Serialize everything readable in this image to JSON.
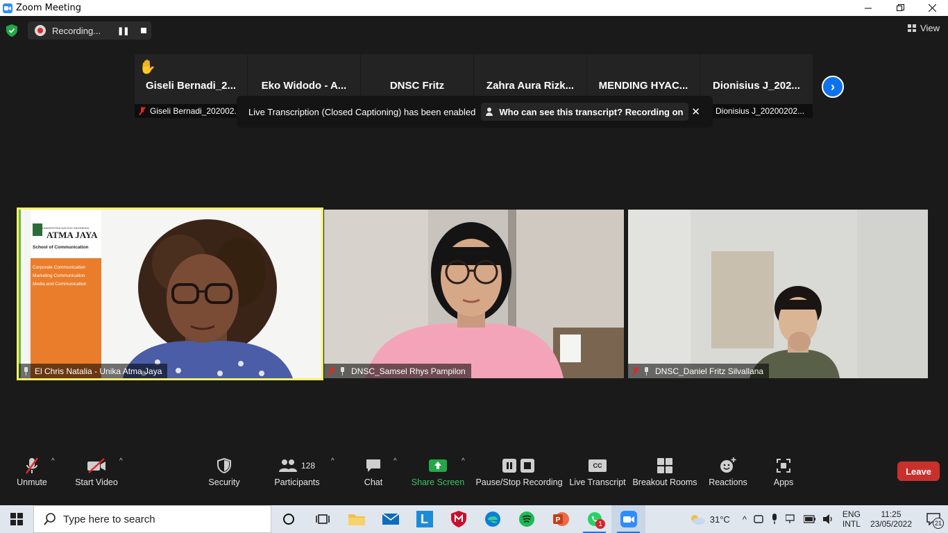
{
  "window": {
    "title": "Zoom Meeting",
    "controls": [
      "—",
      "❐",
      "✕"
    ]
  },
  "topbar": {
    "recording_label": "Recording...",
    "view_label": "View"
  },
  "thumbnails": [
    {
      "name": "Giseli  Bernadi_2...",
      "label": "Giseli Bernadi_202002...",
      "hand": true
    },
    {
      "name": "Eko Widodo - A...",
      "label": ""
    },
    {
      "name": "DNSC Fritz",
      "label": ""
    },
    {
      "name": "Zahra Aura Rizk...",
      "label": ""
    },
    {
      "name": "MENDING  HYAC...",
      "label": ""
    },
    {
      "name": "Dionisius J_202...",
      "label": "Dionisius J_20200202..."
    }
  ],
  "toast": {
    "message": "Live Transcription (Closed Captioning) has been enabled",
    "link": "Who can see this transcript? Recording on"
  },
  "videos": [
    {
      "name": "El Chris Natalia - Unika Atma Jaya",
      "banner": {
        "university": "UNIVERSITAS KATOLIK INDONESIA",
        "brand": "ATMA JAYA",
        "school": "School of Communication",
        "programs": [
          "Corporate Communication",
          "Marketing Communication",
          "Media and Communication"
        ]
      }
    },
    {
      "name": "DNSC_Samsel Rhys Pampilon"
    },
    {
      "name": "DNSC_Daniel Fritz Silvallana"
    }
  ],
  "toolbar": {
    "unmute": "Unmute",
    "start_video": "Start Video",
    "security": "Security",
    "participants": "Participants",
    "participants_count": "128",
    "chat": "Chat",
    "share_screen": "Share Screen",
    "pause_stop_recording": "Pause/Stop Recording",
    "live_transcript": "Live Transcript",
    "live_transcript_badge": "CC",
    "breakout_rooms": "Breakout Rooms",
    "reactions": "Reactions",
    "apps": "Apps",
    "leave": "Leave"
  },
  "taskbar": {
    "search_placeholder": "Type here to search",
    "weather": "31°C",
    "lang_top": "ENG",
    "lang_bottom": "INTL",
    "time": "11:25",
    "date": "23/05/2022",
    "notification_count": "21",
    "whatsapp_badge": "1"
  },
  "colors": {
    "background": "#1a1a1a",
    "active_speaker": "#f7f06a",
    "accent_blue": "#0e72ed",
    "share_green": "#23a846",
    "leave_red": "#c9302c",
    "taskbar": "#dfe6ee"
  }
}
